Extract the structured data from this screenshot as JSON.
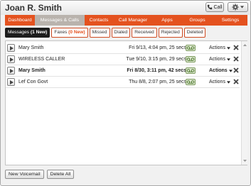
{
  "header": {
    "user_name": "Joan R. Smith",
    "call_label": "Call",
    "call_icon": "phone-icon",
    "settings_icon": "gear-icon"
  },
  "nav": {
    "tabs": [
      {
        "label": "Dashboard",
        "active": false
      },
      {
        "label": "Messages & Calls",
        "active": true
      },
      {
        "label": "Contacts",
        "active": false
      },
      {
        "label": "Call Manager",
        "active": false
      },
      {
        "label": "Apps",
        "active": false
      },
      {
        "label": "Groups",
        "active": false
      },
      {
        "label": "Settings",
        "active": false
      }
    ],
    "accent_color": "#e4521f",
    "active_color": "#b9b3ad"
  },
  "subtabs": [
    {
      "label": "Messages",
      "count": "(1 New)",
      "active": true
    },
    {
      "label": "Faxes",
      "count": "(0 New)",
      "active": false
    },
    {
      "label": "Missed",
      "active": false
    },
    {
      "label": "Dialed",
      "active": false
    },
    {
      "label": "Received",
      "active": false
    },
    {
      "label": "Rejected",
      "active": false
    },
    {
      "label": "Deleted",
      "active": false
    }
  ],
  "messages": [
    {
      "caller": "Mary Smith",
      "meta": "Fri 9/13, 4:04 pm, 25 secs",
      "unread": false,
      "actions_label": "Actions"
    },
    {
      "caller": "WIRELESS CALLER",
      "meta": "Tue 9/10, 3:15 pm, 29 secs",
      "unread": false,
      "actions_label": "Actions"
    },
    {
      "caller": "Mary Smith",
      "meta": "Fri 8/30, 3:11 pm, 42 secs",
      "unread": true,
      "actions_label": "Actions"
    },
    {
      "caller": "Lef Con Govt",
      "meta": "Thu 8/8, 2:07 pm, 25 secs",
      "unread": false,
      "actions_label": "Actions"
    }
  ],
  "footer": {
    "new_voicemail": "New Voicemail",
    "delete_all": "Delete All"
  }
}
